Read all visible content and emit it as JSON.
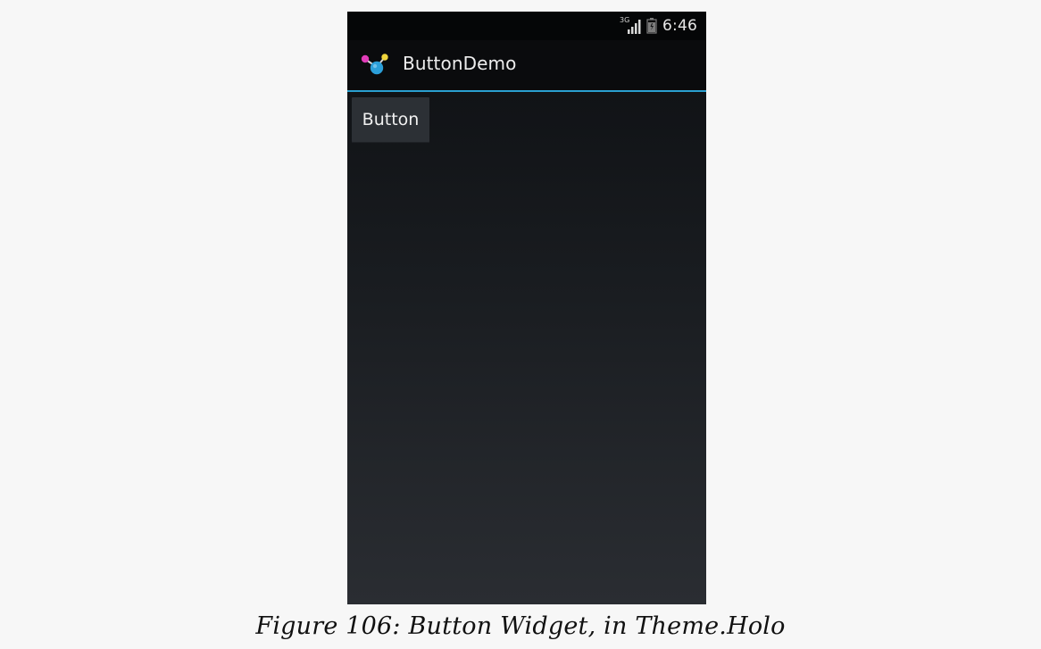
{
  "status_bar": {
    "network_label": "3G",
    "time": "6:46"
  },
  "action_bar": {
    "title": "ButtonDemo",
    "icon_name": "molecule-icon"
  },
  "content": {
    "button_label": "Button"
  },
  "figure_caption": "Figure 106: Button Widget, in Theme.Holo",
  "colors": {
    "accent": "#2a9fd0"
  }
}
